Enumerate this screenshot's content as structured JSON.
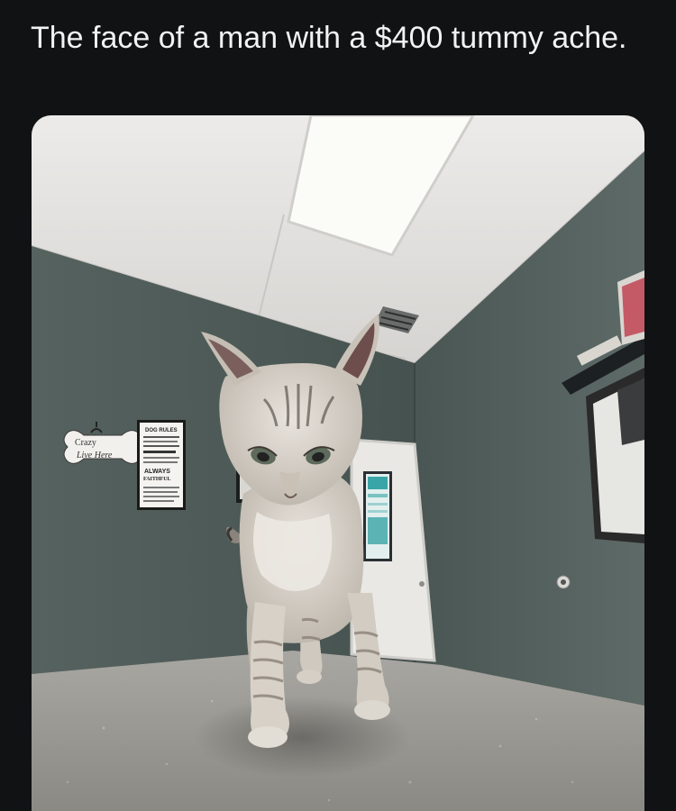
{
  "post": {
    "caption": "The face of a man with a $400 tummy ache."
  },
  "photo": {
    "subject": "kitten standing on exam table in a vet room",
    "signs": {
      "crazy_dog_sign_line1": "Crazy",
      "crazy_dog_sign_line2": "Live Here",
      "dog_rules_title": "DOG RULES",
      "dog_rules_always": "ALWAYS",
      "dog_rules_faithful": "FAITHFUL"
    }
  },
  "colors": {
    "page_background": "#111214",
    "wall": "#4d5a58",
    "ceiling": "#e4e2e0",
    "table": "#9a9893"
  }
}
